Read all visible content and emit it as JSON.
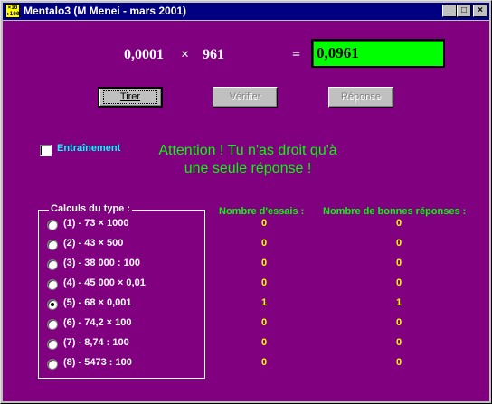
{
  "window": {
    "title": "Mentalo3 (M Menei - mars 2001)",
    "icon_text": "×10 :100",
    "controls": {
      "minimize": "_",
      "maximize": "□",
      "close": "×"
    }
  },
  "calc": {
    "operand1": "0,0001",
    "operator": "×",
    "operand2": "961",
    "equals": "=",
    "result": "0,0961"
  },
  "buttons": {
    "tirer": "Tirer",
    "verifier": "Vérifier",
    "reponse": "Réponse"
  },
  "training": {
    "label": "Entraînement",
    "checked": false
  },
  "message": {
    "line1": "Attention ! Tu n'as droit qu'à",
    "line2": "une seule réponse !"
  },
  "group": {
    "title": "Calculs du type :",
    "options": [
      {
        "label": "(1) - 73 × 1000",
        "selected": false
      },
      {
        "label": "(2) - 43 × 500",
        "selected": false
      },
      {
        "label": "(3) - 38 000 : 100",
        "selected": false
      },
      {
        "label": "(4) - 45 000 × 0,01",
        "selected": false
      },
      {
        "label": "(5) - 68 × 0,001",
        "selected": true
      },
      {
        "label": "(6) - 74,2 × 100",
        "selected": false
      },
      {
        "label": "(7) - 8,74 : 100",
        "selected": false
      },
      {
        "label": "(8) - 5473 : 100",
        "selected": false
      }
    ]
  },
  "stats": {
    "essais_header": "Nombre d'essais :",
    "bonnes_header": "Nombre de bonnes réponses :",
    "essais": [
      "0",
      "0",
      "0",
      "0",
      "1",
      "0",
      "0",
      "0"
    ],
    "bonnes": [
      "0",
      "0",
      "0",
      "0",
      "1",
      "0",
      "0",
      "0"
    ]
  },
  "colors": {
    "background": "#800080",
    "result_bg": "#00ff00",
    "accent_green": "#00ff00",
    "accent_cyan": "#00ffff",
    "accent_yellow": "#ffff00",
    "titlebar": "#000080"
  }
}
